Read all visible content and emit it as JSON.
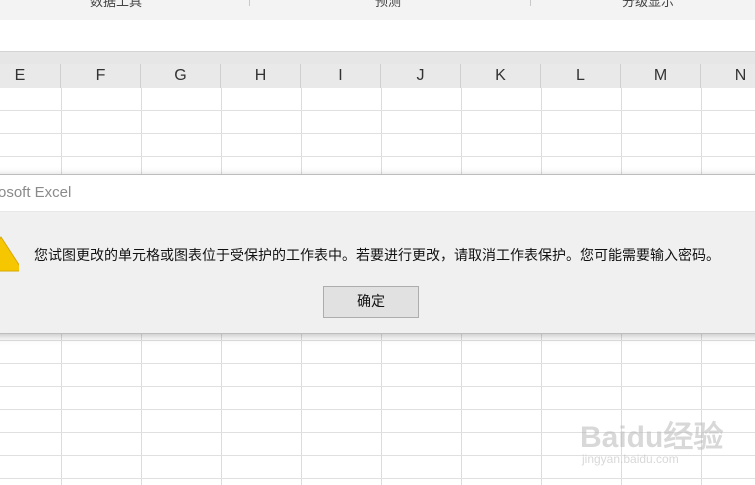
{
  "ribbon": {
    "group_labels": [
      "数据工具",
      "预测",
      "分级显示"
    ]
  },
  "columns": [
    "E",
    "F",
    "G",
    "H",
    "I",
    "J",
    "K",
    "L",
    "M",
    "N"
  ],
  "dialog": {
    "title": "rosoft Excel",
    "message": "您试图更改的单元格或图表位于受保护的工作表中。若要进行更改，请取消工作表保护。您可能需要输入密码。",
    "ok_label": "确定"
  },
  "cell_fragment": "\\",
  "watermark": {
    "text": "Baidu经验",
    "sub": "jingyan.baidu.com"
  },
  "colors": {
    "warning": "#f6c700",
    "header_bg": "#e9e9e9",
    "dialog_bg": "#f0f0f0"
  }
}
